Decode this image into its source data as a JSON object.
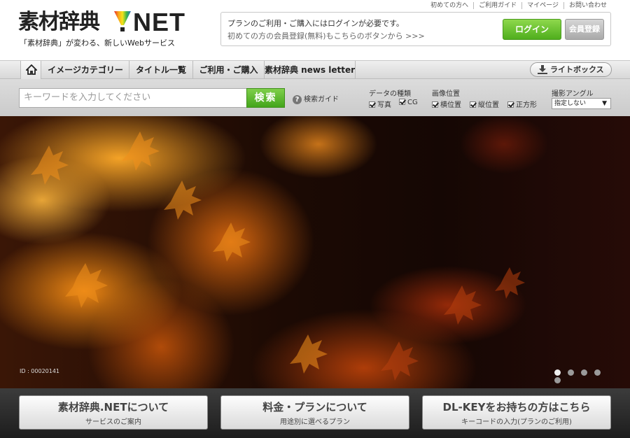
{
  "header": {
    "logo_text": "素材辞典",
    "logo_net": "NET",
    "tagline": "「素材辞典」が変わる、新しいWebサービス",
    "top_links": [
      "初めての方へ",
      "ご利用ガイド",
      "マイページ",
      "お問い合わせ"
    ]
  },
  "login": {
    "line1": "プランのご利用・ご購入にはログインが必要です。",
    "line2": "初めての方の会員登録(無料)もこちらのボタンから >>>",
    "login_label": "ログイン",
    "register_label": "会員登録"
  },
  "nav": {
    "items": [
      "イメージカテゴリー",
      "タイトル一覧",
      "ご利用・ご購入",
      "素材辞典 news letter"
    ],
    "lightbox": "ライトボックス"
  },
  "search": {
    "placeholder": "キーワードを入力してください",
    "button": "検索",
    "guide": "検索ガイド",
    "data_type_label": "データの種類",
    "data_types": [
      "写真",
      "CG"
    ],
    "orientation_label": "画像位置",
    "orientations": [
      "横位置",
      "縦位置",
      "正方形"
    ],
    "angle_label": "撮影アングル",
    "angle_value": "指定しない"
  },
  "hero": {
    "image_id": "ID : 00020141",
    "slides": 5,
    "active_slide": 1
  },
  "bottom_buttons": [
    {
      "title": "素材辞典.NETについて",
      "sub": "サービスのご案内"
    },
    {
      "title": "料金・プランについて",
      "sub": "用途別に選べるプラン"
    },
    {
      "title": "DL-KEYをお持ちの方はこちら",
      "sub": "キーコードの入力(プランのご利用)"
    }
  ],
  "colors": {
    "accent_green": "#4fae1d",
    "nav_bg": "#e0e0e0",
    "bottom_bg": "#2a2a2a"
  }
}
